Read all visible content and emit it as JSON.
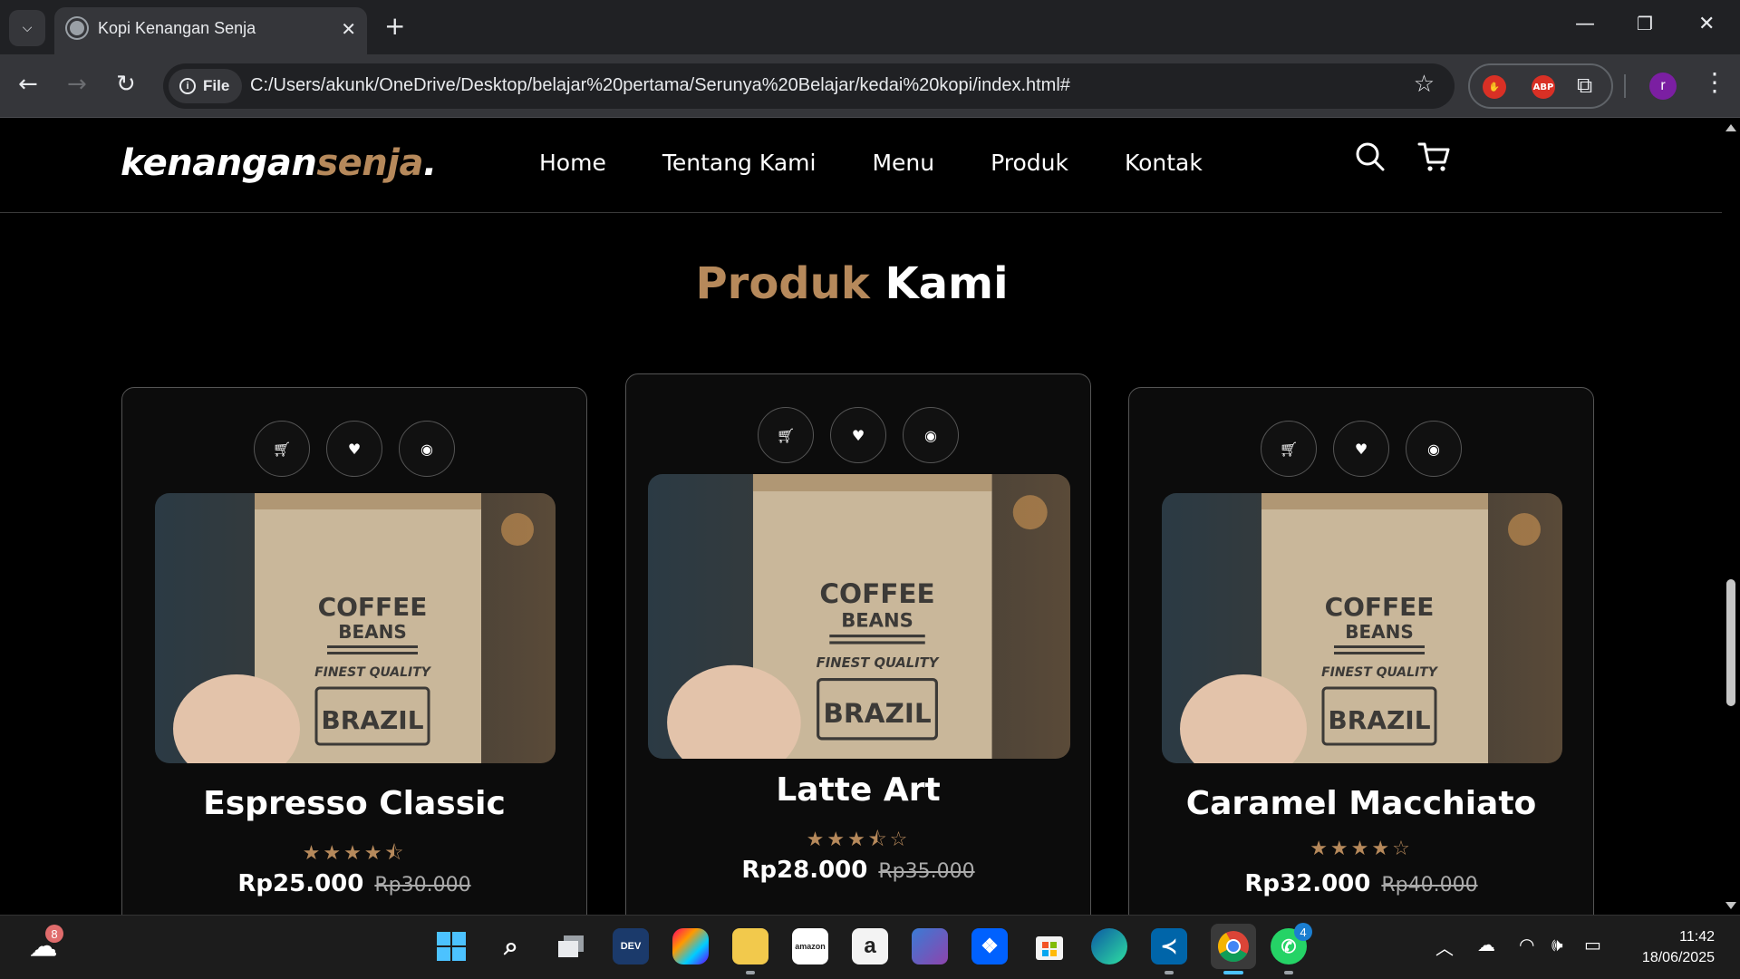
{
  "browser": {
    "tab_title": "Kopi Kenangan Senja",
    "url_chip": "File",
    "url": "C:/Users/akunk/OneDrive/Desktop/belajar%20pertama/Serunya%20Belajar/kedai%20kopi/index.html#",
    "profile_initial": "r",
    "ext_abp": "ABP"
  },
  "site": {
    "logo_main": "kenangan",
    "logo_accent": "senja",
    "logo_dot": ".",
    "menu": [
      "Home",
      "Tentang Kami",
      "Menu",
      "Produk",
      "Kontak"
    ],
    "section_title_accent": "Produk",
    "section_title_main": "Kami",
    "accent_color": "#b6895b"
  },
  "products": [
    {
      "name": "Espresso Classic",
      "rating": 4.5,
      "stars": "★★★★⯪",
      "price": "Rp25.000",
      "old_price": "Rp30.000",
      "image_label": [
        "COFFEE",
        "BEANS",
        "FINEST QUALITY",
        "BRAZIL"
      ]
    },
    {
      "name": "Latte Art",
      "rating": 3.5,
      "stars": "★★★⯪☆",
      "price": "Rp28.000",
      "old_price": "Rp35.000",
      "image_label": [
        "COFFEE",
        "BEANS",
        "FINEST QUALITY",
        "BRAZIL"
      ]
    },
    {
      "name": "Caramel Macchiato",
      "rating": 4,
      "stars": "★★★★☆",
      "price": "Rp32.000",
      "old_price": "Rp40.000",
      "image_label": [
        "COFFEE",
        "BEANS",
        "FINEST QUALITY",
        "BRAZIL"
      ]
    }
  ],
  "taskbar": {
    "weather_badge": "8",
    "whatsapp_badge": "4",
    "time": "11:42",
    "date": "18/06/2025",
    "dev_label": "DEV",
    "amazon_label": "amazon"
  }
}
